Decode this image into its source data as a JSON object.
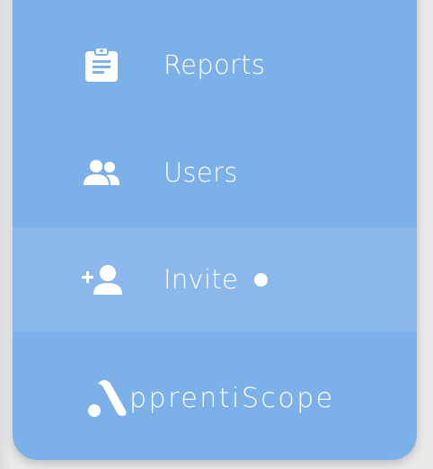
{
  "nav": {
    "items": [
      {
        "label": "Reports",
        "icon": "clipboard-icon",
        "active": false
      },
      {
        "label": "Users",
        "icon": "users-icon",
        "active": false
      },
      {
        "label": "Invite",
        "icon": "add-user-icon",
        "active": true,
        "has_notification_dot": true
      }
    ]
  },
  "brand": {
    "name": "pprentiScope",
    "logo_icon": "apprentiscope-logo-mark"
  },
  "colors": {
    "panel_background": "#7cb0e8",
    "active_item_background": "#8ab8eb",
    "text": "#ffffff"
  }
}
